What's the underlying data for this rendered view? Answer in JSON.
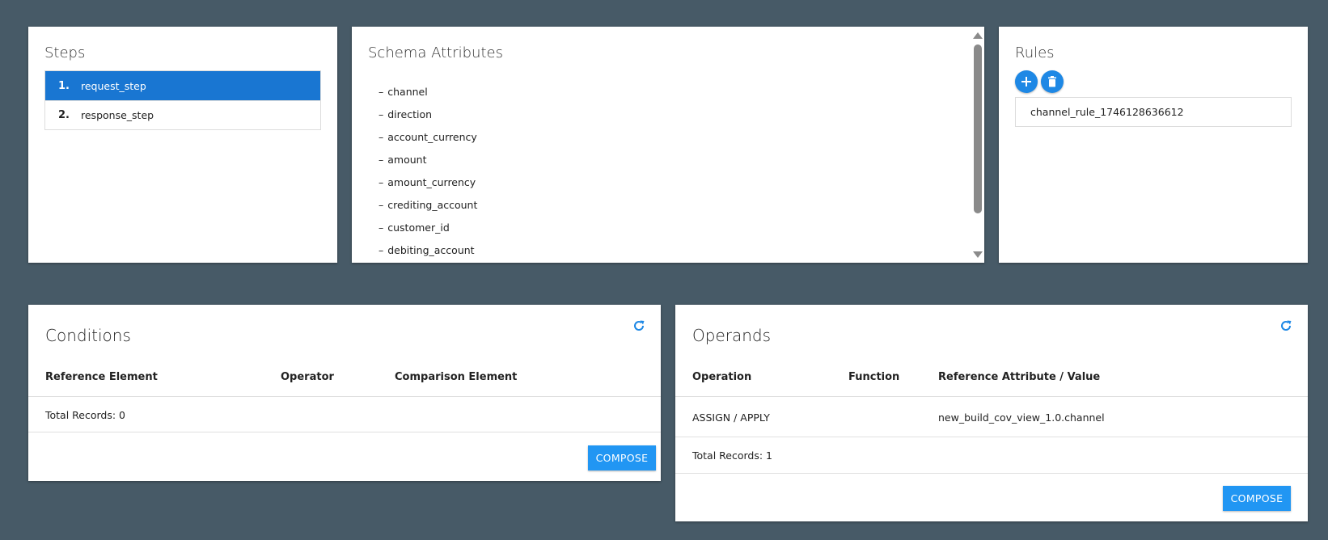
{
  "steps": {
    "title": "Steps",
    "items": [
      {
        "num": "1.",
        "label": "request_step",
        "selected": true
      },
      {
        "num": "2.",
        "label": "response_step",
        "selected": false
      }
    ]
  },
  "schema": {
    "title": "Schema Attributes",
    "attributes": [
      "channel",
      "direction",
      "account_currency",
      "amount",
      "amount_currency",
      "crediting_account",
      "customer_id",
      "debiting_account"
    ]
  },
  "rules": {
    "title": "Rules",
    "add_icon": "plus-icon",
    "delete_icon": "trash-icon",
    "items": [
      "channel_rule_1746128636612"
    ]
  },
  "conditions": {
    "title": "Conditions",
    "columns": [
      "Reference Element",
      "Operator",
      "Comparison Element"
    ],
    "total_records": "Total Records: 0",
    "compose_label": "COMPOSE"
  },
  "operands": {
    "title": "Operands",
    "columns": [
      "Operation",
      "Function",
      "Reference Attribute / Value"
    ],
    "rows": [
      {
        "operation": "ASSIGN / APPLY",
        "function": "",
        "reference": "new_build_cov_view_1.0.channel"
      }
    ],
    "total_records": "Total Records: 1",
    "compose_label": "COMPOSE"
  },
  "colors": {
    "background": "#475a67",
    "selected_step": "#1976d2",
    "accent": "#2196f3"
  }
}
